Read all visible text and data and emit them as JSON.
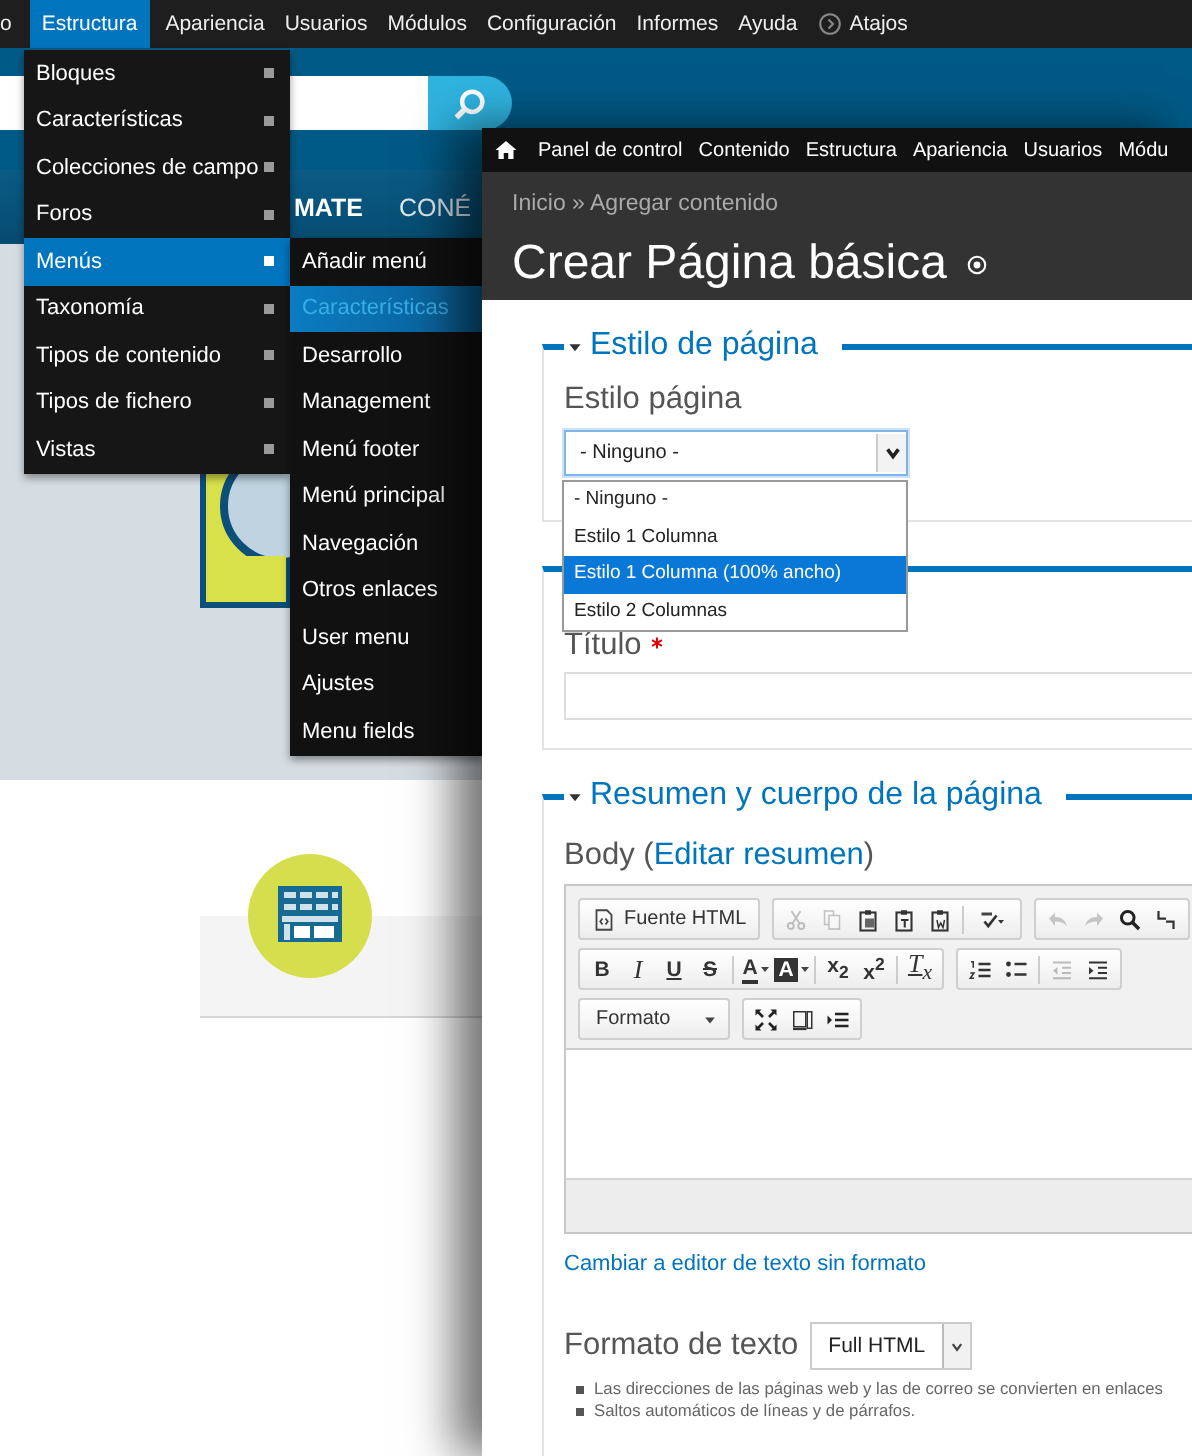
{
  "background_page": {
    "toolbar": {
      "items": [
        {
          "label": "o",
          "kind": "link",
          "selected": false
        },
        {
          "label": "Estructura",
          "kind": "link",
          "selected": true
        },
        {
          "label": "Apariencia",
          "kind": "link",
          "selected": false
        },
        {
          "label": "Usuarios",
          "kind": "link",
          "selected": false
        },
        {
          "label": "Módulos",
          "kind": "link",
          "selected": false
        },
        {
          "label": "Configuración",
          "kind": "link",
          "selected": false
        },
        {
          "label": "Informes",
          "kind": "link",
          "selected": false
        },
        {
          "label": "Ayuda",
          "kind": "link",
          "selected": false
        },
        {
          "label": "Atajos",
          "kind": "shortcut",
          "selected": false
        }
      ]
    },
    "nav": [
      "MATE",
      "CONÉ"
    ]
  },
  "structure_menu": {
    "items": [
      {
        "label": "Bloques",
        "selected": false
      },
      {
        "label": "Características",
        "selected": false
      },
      {
        "label": "Colecciones de campo",
        "selected": false
      },
      {
        "label": "Foros",
        "selected": false
      },
      {
        "label": "Menús",
        "selected": true
      },
      {
        "label": "Taxonomía",
        "selected": false
      },
      {
        "label": "Tipos de contenido",
        "selected": false
      },
      {
        "label": "Tipos de fichero",
        "selected": false
      },
      {
        "label": "Vistas",
        "selected": false
      }
    ]
  },
  "menus_submenu": {
    "items": [
      {
        "label": "Añadir menú",
        "selected": false
      },
      {
        "label": "Características",
        "selected": true
      },
      {
        "label": "Desarrollo",
        "selected": false
      },
      {
        "label": "Management",
        "selected": false
      },
      {
        "label": "Menú footer",
        "selected": false
      },
      {
        "label": "Menú principal",
        "selected": false
      },
      {
        "label": "Navegación",
        "selected": false
      },
      {
        "label": "Otros enlaces",
        "selected": false
      },
      {
        "label": "User menu",
        "selected": false
      },
      {
        "label": "Ajustes",
        "selected": false
      },
      {
        "label": "Menu fields",
        "selected": false
      }
    ]
  },
  "editor_window": {
    "toolbar": {
      "items": [
        "Panel de control",
        "Contenido",
        "Estructura",
        "Apariencia",
        "Usuarios",
        "Módu"
      ]
    },
    "breadcrumb": "Inicio » Agregar contenido",
    "title": "Crear Página básica",
    "page_style": {
      "legend": "Estilo de página",
      "expanded": true,
      "label": "Estilo página",
      "select": {
        "value": "- Ninguno -",
        "open": true,
        "options": [
          {
            "label": "- Ninguno -",
            "highlighted": false
          },
          {
            "label": "Estilo 1 Columna",
            "highlighted": false
          },
          {
            "label": "Estilo 1 Columna (100% ancho)",
            "highlighted": true
          },
          {
            "label": "Estilo 2 Columnas",
            "highlighted": false
          }
        ]
      }
    },
    "title_field": {
      "label": "Título",
      "required": true
    },
    "body_section": {
      "legend": "Resumen y cuerpo de la página",
      "expanded": true,
      "label": "Body (",
      "link": "Editar resumen",
      "label_end": ")",
      "editor": {
        "toolbar_rows": [
          [
            {
              "sections": [
                [
                  {
                    "kind": "source",
                    "label": "Fuente HTML",
                    "disabled": false
                  }
                ]
              ]
            },
            {
              "sections": [
                [
                  {
                    "kind": "cut",
                    "disabled": true
                  },
                  {
                    "kind": "copy",
                    "disabled": true
                  },
                  {
                    "kind": "paste",
                    "disabled": false
                  },
                  {
                    "kind": "paste-text",
                    "disabled": false
                  },
                  {
                    "kind": "paste-word",
                    "disabled": false
                  }
                ],
                [
                  {
                    "kind": "spellcheck",
                    "disabled": false
                  }
                ]
              ]
            },
            {
              "sections": [
                [
                  {
                    "kind": "undo",
                    "disabled": true
                  },
                  {
                    "kind": "redo",
                    "disabled": true
                  },
                  {
                    "kind": "find",
                    "disabled": false
                  },
                  {
                    "kind": "replace",
                    "disabled": false
                  }
                ]
              ]
            }
          ],
          [
            {
              "sections": [
                [
                  {
                    "kind": "bold",
                    "label": "B",
                    "disabled": false
                  },
                  {
                    "kind": "italic",
                    "label": "I",
                    "disabled": false
                  },
                  {
                    "kind": "underline",
                    "label": "U",
                    "disabled": false
                  },
                  {
                    "kind": "strike",
                    "label": "S",
                    "disabled": false
                  }
                ],
                [
                  {
                    "kind": "textcolor",
                    "label": "A",
                    "disabled": false
                  },
                  {
                    "kind": "bgcolor",
                    "label": "A",
                    "disabled": false
                  }
                ],
                [
                  {
                    "kind": "subscript",
                    "label": "x$_{2}$",
                    "disabled": false
                  },
                  {
                    "kind": "superscript",
                    "label": "x$^{2}$",
                    "disabled": false
                  }
                ],
                [
                  {
                    "kind": "removeformat",
                    "label": "T$_{x}$",
                    "disabled": false
                  }
                ]
              ]
            },
            {
              "sections": [
                [
                  {
                    "kind": "numlist",
                    "disabled": false
                  },
                  {
                    "kind": "bullist",
                    "disabled": false
                  }
                ],
                [
                  {
                    "kind": "outdent",
                    "disabled": true
                  },
                  {
                    "kind": "indent",
                    "disabled": false
                  }
                ]
              ]
            }
          ],
          [
            {
              "sections": [
                [
                  {
                    "kind": "combo",
                    "label": "Formato",
                    "disabled": false
                  }
                ]
              ]
            },
            {
              "sections": [
                [
                  {
                    "kind": "maximize",
                    "disabled": false
                  },
                  {
                    "kind": "showblocks",
                    "disabled": false
                  },
                  {
                    "kind": "blocklist",
                    "disabled": false
                  }
                ]
              ]
            }
          ]
        ]
      },
      "switch_link": "Cambiar a editor de texto sin formato",
      "format_label": "Formato de texto",
      "format_value": "Full HTML",
      "tips": [
        "Las direcciones de las páginas web y las de correo se convierten en enlaces",
        "Saltos automáticos de líneas y de párrafos."
      ]
    }
  }
}
